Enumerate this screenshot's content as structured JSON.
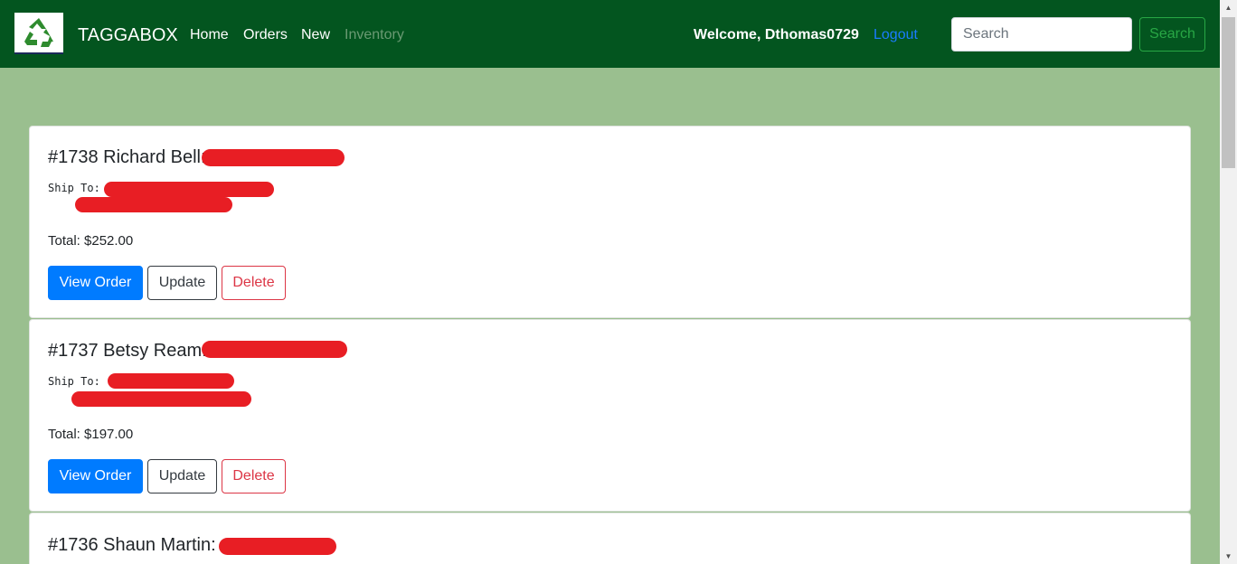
{
  "nav": {
    "brand": "TAGGABOX",
    "links": [
      "Home",
      "Orders",
      "New",
      "Inventory"
    ],
    "welcome": "Welcome, Dthomas0729",
    "logout": "Logout",
    "search_placeholder": "Search",
    "search_button": "Search"
  },
  "orders": [
    {
      "title": "#1738 Richard Bell:",
      "ship_label": "Ship To:",
      "total": "Total: $252.00",
      "view": "View Order",
      "update": "Update",
      "delete": "Delete"
    },
    {
      "title": "#1737 Betsy Ream:",
      "ship_label": "Ship To:",
      "total": "Total: $197.00",
      "view": "View Order",
      "update": "Update",
      "delete": "Delete"
    },
    {
      "title": "#1736 Shaun Martin:"
    }
  ],
  "icons": {
    "logo": "recycle-icon"
  },
  "colors": {
    "navbar": "#03551f",
    "page_bg": "#9abf8f",
    "primary": "#007bff",
    "danger": "#dc3545",
    "success": "#28a745",
    "redaction": "#e81e24"
  }
}
